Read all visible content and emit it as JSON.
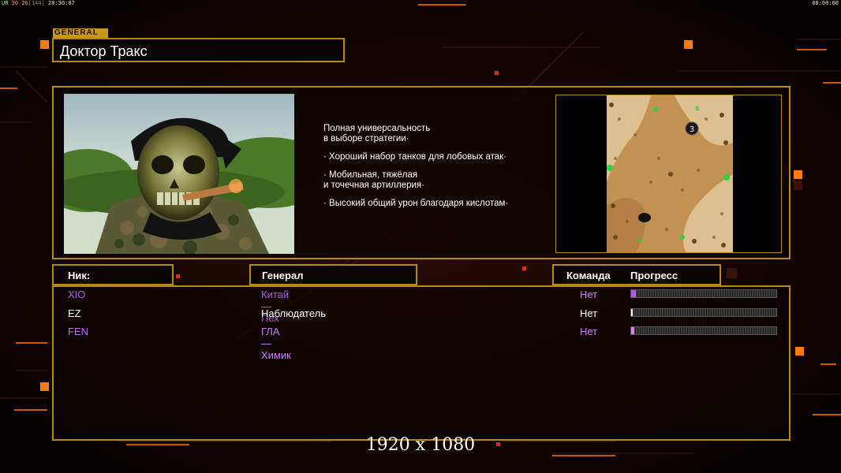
{
  "hud": {
    "left_prefix": "UR",
    "fps": "30",
    "logic": "26",
    "ping": "[144]",
    "clock": "20:30:07",
    "right_clock": "00:00:00"
  },
  "header": {
    "tag": "GENERAL",
    "general_name": "Доктор Тракс"
  },
  "description": [
    "Полная универсальность\nв выборе стратегии·",
    "· Хороший набор танков для лобовых атак·",
    "· Мобильная, тяжёлая\nи точечная артиллерия·",
    "· Высокий общий урон благодаря кислотам·"
  ],
  "minimap": {
    "player_marker": "3",
    "supply_label": "$"
  },
  "table": {
    "col_nick": "Ник:",
    "col_general": "Генерал",
    "col_team": "Команда",
    "col_progress": "Прогресс",
    "rows": [
      {
        "nick": "XIO",
        "general": "Китай — Пех",
        "team": "Нет",
        "progress": 0.03,
        "color": "#b15ce0",
        "nick_color": "#b15ce0",
        "team_color": "#d27cff"
      },
      {
        "nick": "EZ",
        "general": "Наблюдатель",
        "team": "Нет",
        "progress": 0.01,
        "color": "#ffffff",
        "nick_color": "#ffffff",
        "team_color": "#ffffff"
      },
      {
        "nick": "FEN",
        "general": "ГЛА — Химик",
        "team": "Нет",
        "progress": 0.02,
        "color": "#d27cff",
        "nick_color": "#c070f0",
        "team_color": "#d27cff"
      }
    ]
  },
  "resolution_label": "1920 x 1080",
  "colors": {
    "gold": "#b58a13",
    "accent_orange": "#ff6a00"
  }
}
